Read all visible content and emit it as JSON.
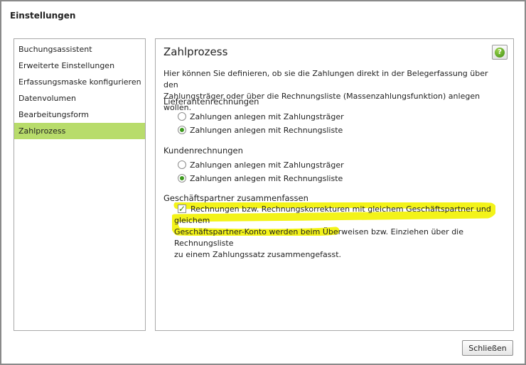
{
  "window": {
    "title": "Einstellungen"
  },
  "sidebar": {
    "items": [
      {
        "label": "Buchungsassistent"
      },
      {
        "label": "Erweiterte Einstellungen"
      },
      {
        "label": "Erfassungsmaske konfigurieren"
      },
      {
        "label": "Datenvolumen"
      },
      {
        "label": "Bearbeitungsform"
      },
      {
        "label": "Zahlprozess"
      }
    ],
    "active_label": "Zahlprozess"
  },
  "content": {
    "title": "Zahlprozess",
    "help_icon": "question-mark-icon",
    "intro_line1": "Hier können Sie definieren, ob sie die Zahlungen direkt in der Belegerfassung über den",
    "intro_line2": "Zahlungsträger oder über die Rechnungsliste (Massenzahlungsfunktion) anlegen wollen.",
    "lieferanten": {
      "title": "Lieferantenrechnungen",
      "option1": "Zahlungen anlegen mit Zahlungsträger",
      "option2": "Zahlungen anlegen mit Rechnungsliste",
      "selected": "option2"
    },
    "kunden": {
      "title": "Kundenrechnungen",
      "option1": "Zahlungen anlegen mit Zahlungsträger",
      "option2": "Zahlungen anlegen mit Rechnungsliste",
      "selected": "option2"
    },
    "partner": {
      "title": "Geschäftspartner zusammenfassen",
      "checked": true,
      "line1": "Rechnungen bzw. Rechnungskorrekturen mit gleichem Geschäftspartner und gleichem",
      "line2": "Geschäftspartner-Konto werden beim Überweisen bzw. Einziehen über die Rechnungsliste",
      "line3": "zu einem Zahlungssatz zusammengefasst."
    }
  },
  "footer": {
    "close_label": "Schließen"
  },
  "colors": {
    "active_item": "#b8dc6b",
    "radio_selected": "#3d9a1e",
    "highlight": "#f2f200"
  }
}
